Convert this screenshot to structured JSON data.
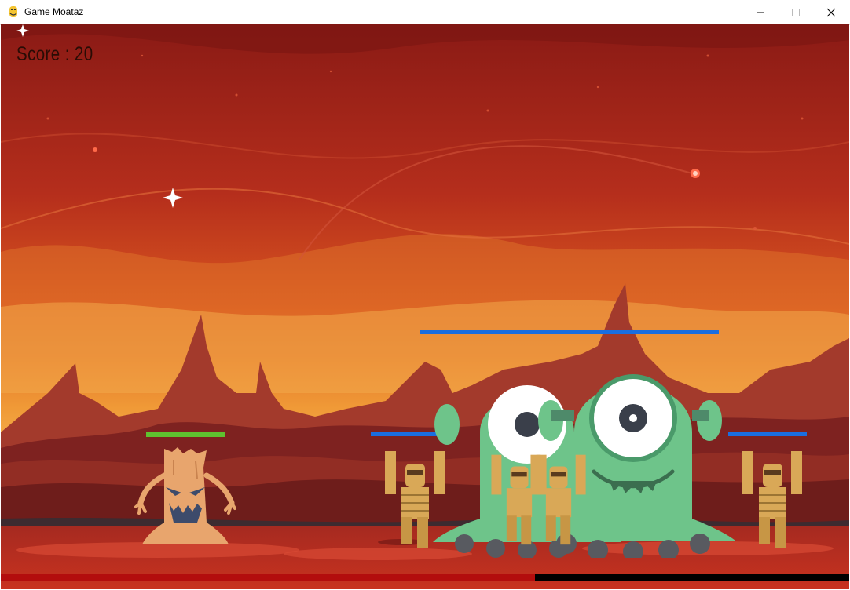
{
  "window": {
    "title": "Game Moataz",
    "app_icon": "python-snake-icon",
    "controls": [
      "minimize-icon",
      "maximize-icon",
      "close-icon"
    ]
  },
  "hud": {
    "score_text": "Score : 20"
  },
  "player": {
    "name": "tree monster",
    "health_fraction": 1.0,
    "health_color": "#5fc12f"
  },
  "enemies": [
    {
      "type": "mummy",
      "health_fraction": 1.0,
      "health_color": "#1a6ee0"
    },
    {
      "type": "mummy",
      "health_fraction": 1.0,
      "health_color": "#1a6ee0"
    },
    {
      "type": "mummy",
      "health_fraction": 1.0,
      "health_color": "#1a6ee0"
    },
    {
      "type": "mummy",
      "health_fraction": 1.0,
      "health_color": "#1a6ee0"
    },
    {
      "type": "alien",
      "health_fraction": 1.0,
      "health_color": "#1a6ee0"
    },
    {
      "type": "alien",
      "health_fraction": 1.0,
      "health_color": "#1a6ee0"
    }
  ],
  "event_bar": {
    "fraction": 0.63,
    "fill_color": "#b30d0d",
    "track_color": "#000000"
  },
  "colors": {
    "sky_top": "#8e1b16",
    "sky_bottom": "#f0a038",
    "ground": "#c8321f",
    "lava": "#d63b2a"
  }
}
